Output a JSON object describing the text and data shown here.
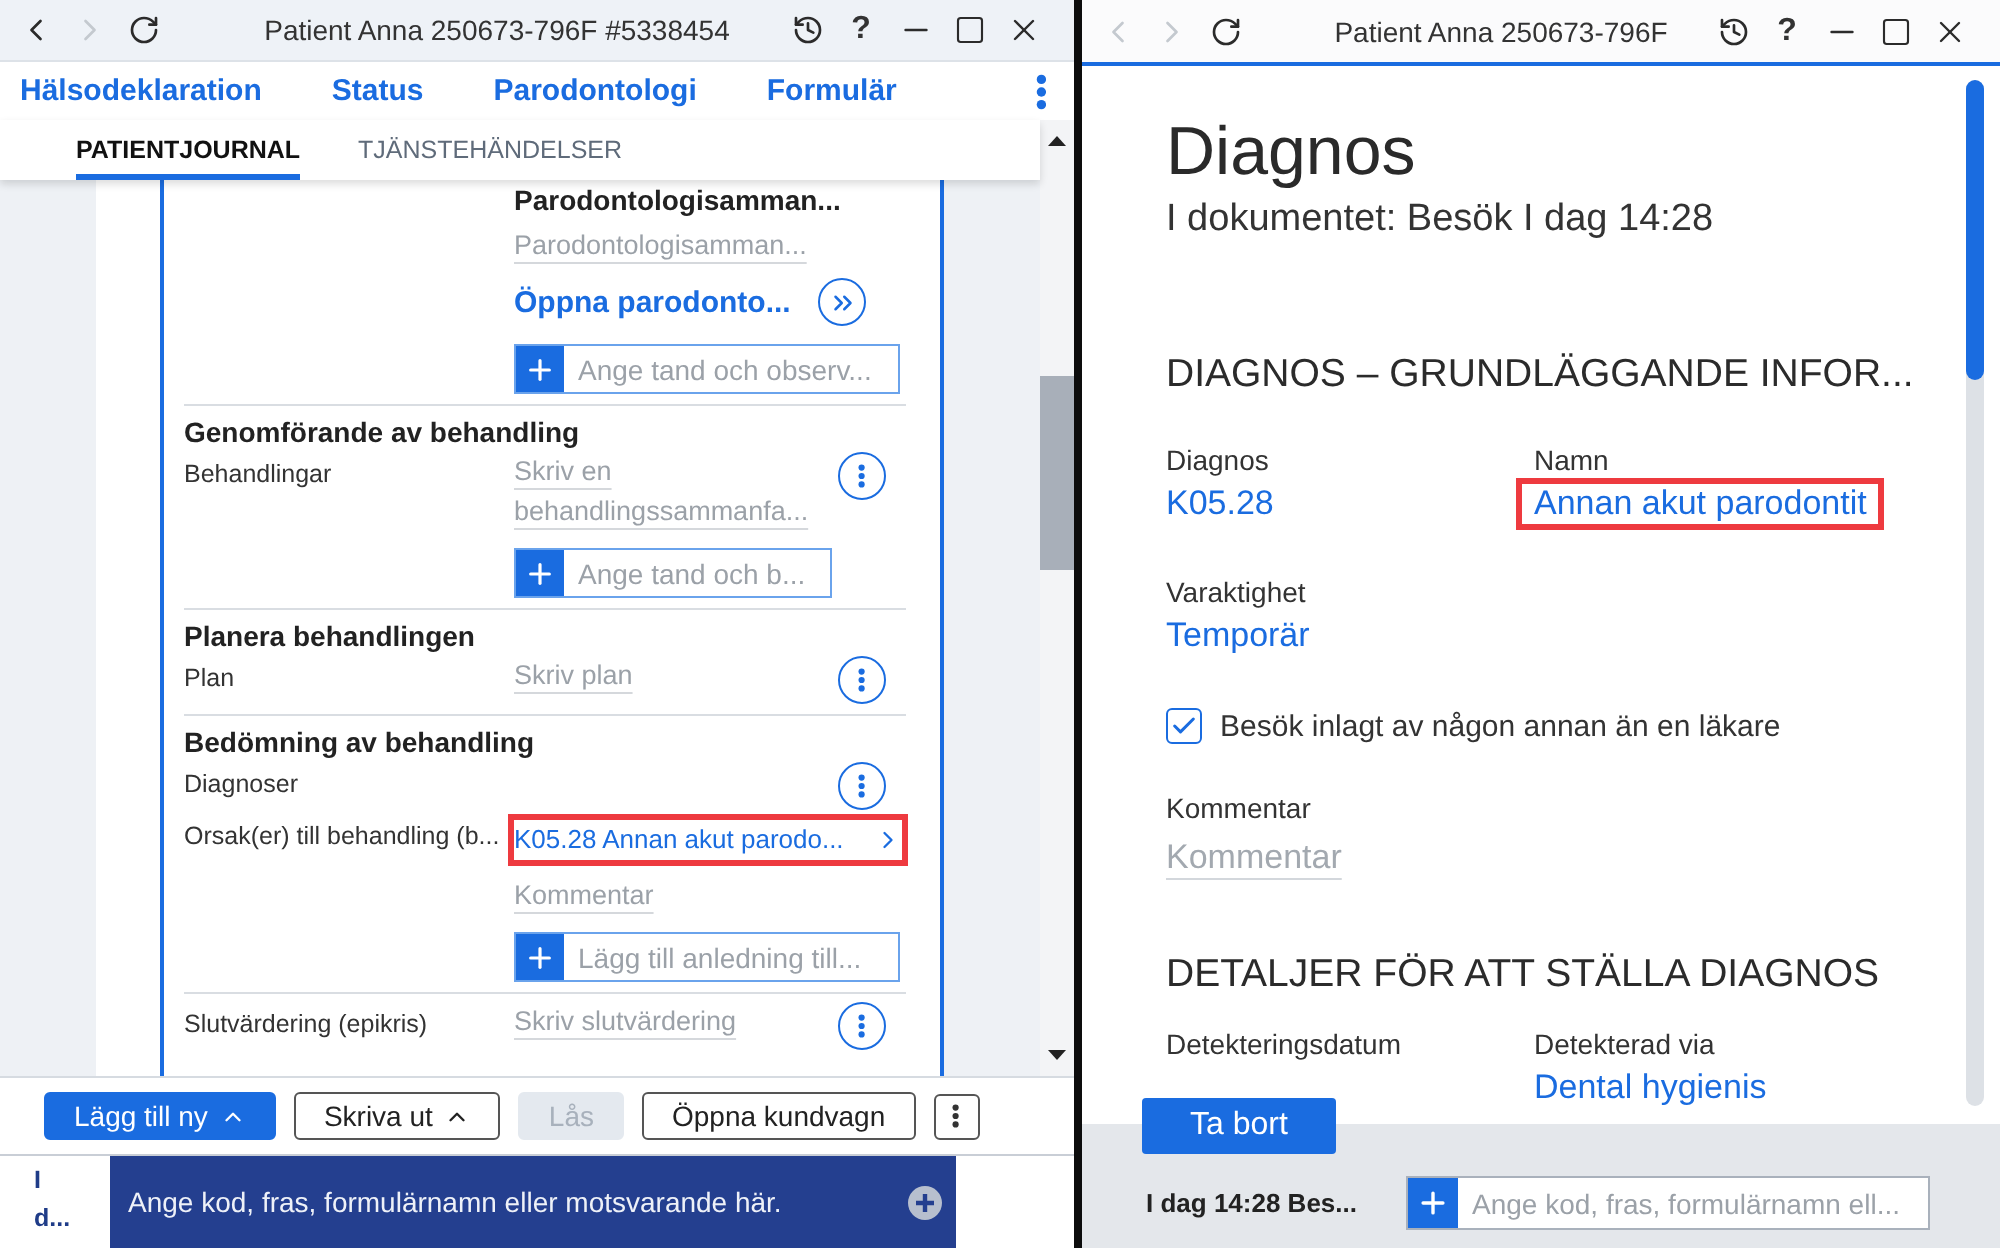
{
  "left_window": {
    "title": "Patient Anna 250673-796F #5338454",
    "back": {
      "disabled": false
    },
    "forward": {
      "disabled": true
    },
    "help": "?",
    "nav_links": [
      "Hälsodeklaration",
      "Status",
      "Parodontologi",
      "Formulär"
    ],
    "tabs": [
      {
        "label": "PATIENTJOURNAL",
        "selected": true
      },
      {
        "label": "TJÄNSTEHÄNDELSER",
        "selected": false
      }
    ],
    "sections": [
      {
        "rows": [
          {
            "menu": false,
            "items": [
              {
                "kind": "heading",
                "text": "Parodontologisamman...",
                "highlighted": false
              },
              {
                "kind": "note",
                "placeholder": "Parodontologisamman...",
                "highlighted": false
              },
              {
                "kind": "link",
                "text": "Öppna parodonto...",
                "highlighted": false
              },
              {
                "kind": "add",
                "placeholder": "Ange tand och observ...",
                "highlighted": false
              }
            ]
          }
        ]
      },
      {
        "title": "Genomförande av behandling",
        "rows": [
          {
            "label": "Behandlingar",
            "menu": true,
            "items": [
              {
                "kind": "note",
                "placeholder": "Skriv en behandlingssammanfa...",
                "highlighted": false
              },
              {
                "kind": "add",
                "placeholder": "Ange tand och b...",
                "highlighted": false
              }
            ]
          }
        ]
      },
      {
        "title": "Planera behandlingen",
        "rows": [
          {
            "label": "Plan",
            "menu": true,
            "items": [
              {
                "kind": "note",
                "placeholder": "Skriv plan",
                "highlighted": false
              }
            ]
          }
        ]
      },
      {
        "title": "Bedömning av behandling",
        "rows": [
          {
            "label": "Diagnoser",
            "menu": true
          },
          {
            "label": "Orsak(er) till behandling (b...",
            "menu": false,
            "items": [
              {
                "kind": "diagnosis",
                "text": "K05.28 Annan akut parodo...",
                "highlighted": true
              },
              {
                "kind": "note",
                "placeholder": "Kommentar",
                "highlighted": false
              },
              {
                "kind": "add",
                "placeholder": "Lägg till anledning till...",
                "highlighted": false
              }
            ]
          }
        ]
      },
      {
        "rows": [
          {
            "label": "Slutvärdering (epikris)",
            "menu": true,
            "items": [
              {
                "kind": "note",
                "placeholder": "Skriv slutvärdering",
                "highlighted": false
              }
            ]
          }
        ]
      }
    ],
    "toolbar": [
      {
        "kind": "primary",
        "label": "Lägg till ny",
        "menu": true,
        "disabled": false
      },
      {
        "kind": "outline",
        "label": "Skriva ut",
        "menu": true,
        "disabled": false
      },
      {
        "kind": "outline",
        "label": "Lås",
        "menu": false,
        "disabled": true
      },
      {
        "kind": "outline",
        "label": "Öppna kundvagn",
        "menu": false,
        "disabled": false
      },
      {
        "kind": "more"
      }
    ],
    "bottom_bar": {
      "context": "I d...",
      "command_placeholder": "Ange kod, fras, formulärnamn eller motsvarande här."
    }
  },
  "right_window": {
    "title": "Patient Anna 250673-796F",
    "back": {
      "disabled": true
    },
    "forward": {
      "disabled": true
    },
    "help": "?",
    "heading": "Diagnos",
    "subtitle": "I dokumentet: Besök I dag 14:28",
    "sections": [
      {
        "title": "DIAGNOS – GRUNDLÄGGANDE INFOR...",
        "fields": [
          {
            "kind": "value",
            "label": "Diagnos",
            "value": "K05.28",
            "highlighted": false
          },
          {
            "kind": "value",
            "label": "Namn",
            "value": "Annan akut parodontit",
            "highlighted": true
          },
          {
            "kind": "value",
            "label": "Varaktighet",
            "value": "Temporär",
            "highlighted": false
          },
          {
            "kind": "checkbox",
            "label": "Besök inlagt av någon annan än en läkare",
            "checked": true,
            "highlighted": false
          },
          {
            "kind": "comment",
            "label": "Kommentar",
            "placeholder": "Kommentar",
            "highlighted": false
          }
        ]
      },
      {
        "title": "DETALJER FÖR ATT STÄLLA DIAGNOS",
        "fields": [
          {
            "kind": "value",
            "label": "Detekteringsdatum",
            "highlighted": false
          },
          {
            "kind": "value",
            "label": "Detekterad via",
            "value": "Dental hygienis",
            "highlighted": false
          }
        ]
      }
    ],
    "delete_button": "Ta bort",
    "footer": {
      "context": "I dag 14:28 Bes...",
      "command_placeholder": "Ange kod, fras, formulärnamn ell..."
    }
  }
}
